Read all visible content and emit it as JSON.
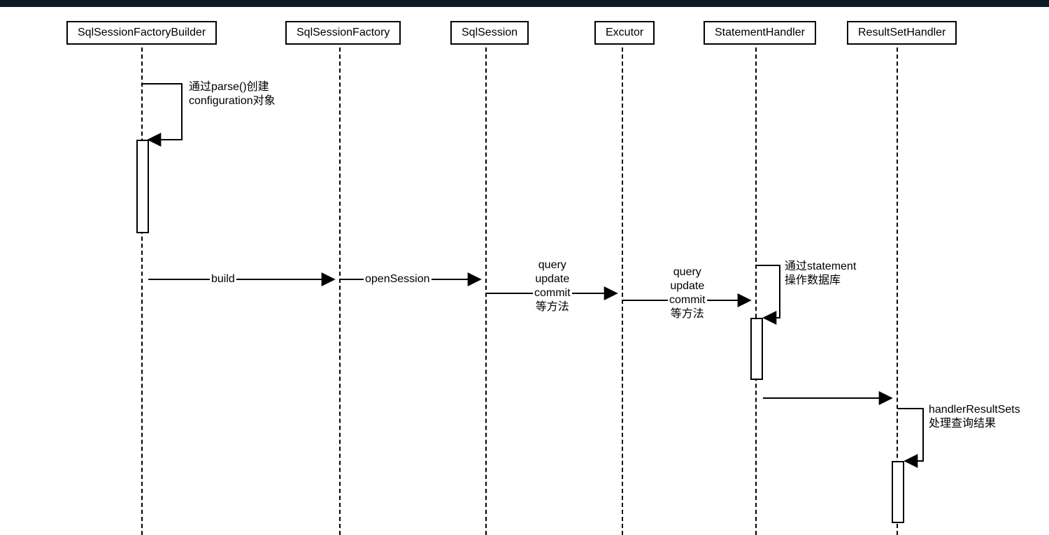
{
  "participants": {
    "p0": "SqlSessionFactoryBuilder",
    "p1": "SqlSessionFactory",
    "p2": "SqlSession",
    "p3": "Excutor",
    "p4": "StatementHandler",
    "p5": "ResultSetHandler"
  },
  "messages": {
    "selfParse": {
      "line1": "通过parse()创建",
      "line2": "configuration对象"
    },
    "build": "build",
    "openSession": "openSession",
    "sessionOps": {
      "line1": "query",
      "line2": "update",
      "line3": "commit",
      "line4": "等方法"
    },
    "executorOps": {
      "line1": "query",
      "line2": "update",
      "line3": "commit",
      "line4": "等方法"
    },
    "statementOp": {
      "line1": "通过statement",
      "line2": "操作数据库"
    },
    "resultOp": {
      "line1": "handlerResultSets",
      "line2": "处理查询结果"
    }
  }
}
